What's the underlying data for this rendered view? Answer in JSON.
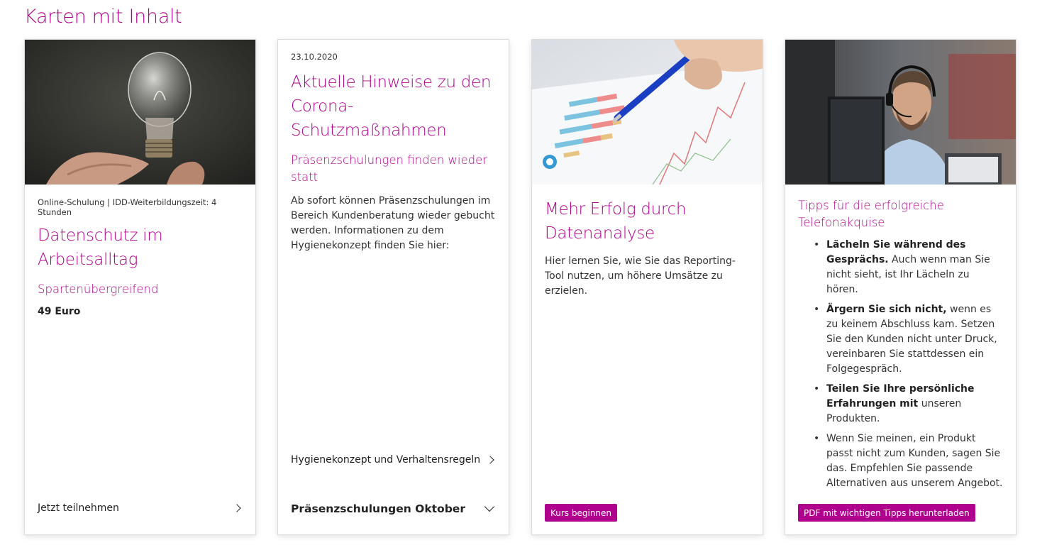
{
  "page": {
    "heading": "Karten mit Inhalt"
  },
  "colors": {
    "accent": "#b0008e",
    "text": "#333333"
  },
  "cards": [
    {
      "image": "light-bulb-photo",
      "meta": "Online-Schulung | IDD-Weiterbildungszeit: 4 Stunden",
      "title": "Datenschutz im Arbeitsalltag",
      "subtitle": "Spartenübergreifend",
      "price": "49 Euro",
      "link": "Jetzt teilnehmen"
    },
    {
      "date": "23.10.2020",
      "title": "Aktuelle Hinweise zu den Corona-Schutzmaßnahmen",
      "subtitle": "Präsenzschulungen finden wieder statt",
      "text": "Ab sofort können Präsenzschulungen im Bereich Kundenberatung wieder gebucht werden. Informationen zu dem Hygienekonzept finden Sie hier:",
      "link": "Hygienekonzept und Verhaltensregeln",
      "accordion": "Präsenzschulungen Oktober"
    },
    {
      "image": "chart-analysis-photo",
      "title": "Mehr Erfolg durch Datenanalyse",
      "text": "Hier lernen Sie, wie Sie das Reporting-Tool nutzen, um höhere Umsätze zu erzielen.",
      "button": "Kurs beginnen"
    },
    {
      "image": "call-center-agent-photo",
      "title": "Tipps für die erfolgreiche Telefonakquise",
      "tips": [
        {
          "bold": "Lächeln Sie während des Gesprächs.",
          "rest": " Auch wenn man Sie nicht sieht, ist Ihr Lächeln zu hören."
        },
        {
          "bold": "Ärgern Sie sich nicht,",
          "rest": " wenn es zu keinem Abschluss kam. Setzen Sie den Kunden nicht unter Druck, vereinbaren Sie stattdessen ein Folgegespräch."
        },
        {
          "bold": "Teilen Sie Ihre persönliche Erfahrungen mit",
          "rest": " unseren Produkten."
        },
        {
          "bold": "",
          "rest": "Wenn Sie meinen, ein Produkt passt nicht zum Kunden, sagen Sie das. Empfehlen Sie passende Alternativen aus unserem Angebot."
        }
      ],
      "button": "PDF mit wichtigen Tipps herunterladen"
    }
  ]
}
